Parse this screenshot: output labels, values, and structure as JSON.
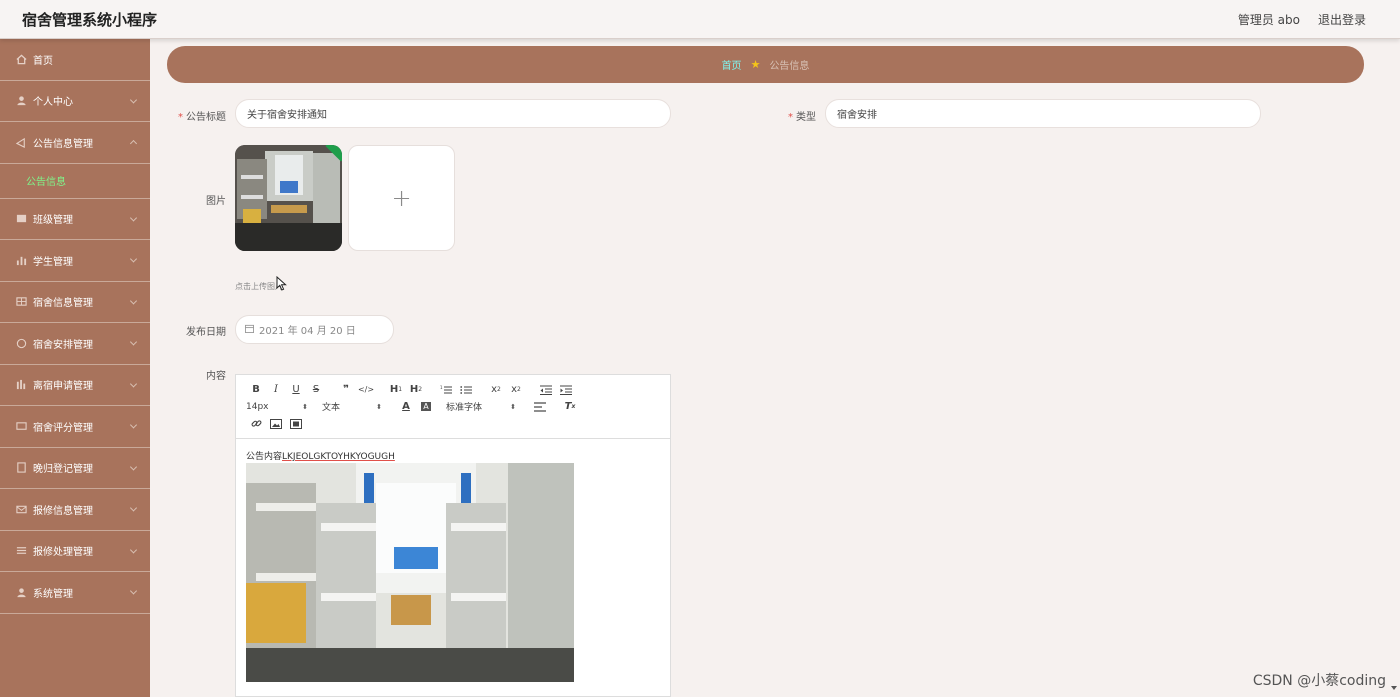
{
  "header": {
    "title": "宿舍管理系统小程序",
    "user_label": "管理员 abo",
    "logout_label": "退出登录"
  },
  "sidebar": {
    "items": [
      {
        "label": "首页",
        "icon": "home-icon",
        "expandable": false
      },
      {
        "label": "个人中心",
        "icon": "user-icon",
        "expandable": true
      },
      {
        "label": "公告信息管理",
        "icon": "megaphone-icon",
        "expandable": true,
        "expanded": true,
        "children": [
          "公告信息"
        ]
      },
      {
        "label": "班级管理",
        "icon": "list-icon",
        "expandable": true
      },
      {
        "label": "学生管理",
        "icon": "bar-chart-icon",
        "expandable": true
      },
      {
        "label": "宿舍信息管理",
        "icon": "grid-icon",
        "expandable": true
      },
      {
        "label": "宿舍安排管理",
        "icon": "circle-icon",
        "expandable": true
      },
      {
        "label": "离宿申请管理",
        "icon": "chart-icon",
        "expandable": true
      },
      {
        "label": "宿舍评分管理",
        "icon": "message-icon",
        "expandable": true
      },
      {
        "label": "晚归登记管理",
        "icon": "document-icon",
        "expandable": true
      },
      {
        "label": "报修信息管理",
        "icon": "envelope-icon",
        "expandable": true
      },
      {
        "label": "报修处理管理",
        "icon": "menu-icon",
        "expandable": true
      },
      {
        "label": "系统管理",
        "icon": "person-icon",
        "expandable": true
      }
    ],
    "active_child": "公告信息"
  },
  "breadcrumb": {
    "home": "首页",
    "current": "公告信息"
  },
  "form": {
    "title_label": "公告标题",
    "title_value": "关于宿舍安排通知",
    "type_label": "类型",
    "type_value": "宿舍安排",
    "image_label": "图片",
    "upload_tip": "点击上传图片",
    "date_label": "发布日期",
    "date_value": "2021 年 04 月 20 日",
    "content_label": "内容"
  },
  "editor": {
    "font_size": "14px",
    "format": "文本",
    "font_family": "标准字体",
    "content_prefix": "公告内容",
    "content_code": "LKJEOLGKTOYHKYOGUGH"
  },
  "watermark": "CSDN @小蔡coding",
  "colors": {
    "sidebar": "#a8735c",
    "accent_green": "#7ff58a",
    "crumb_home": "#7ff5f0",
    "required": "#e0504a"
  }
}
